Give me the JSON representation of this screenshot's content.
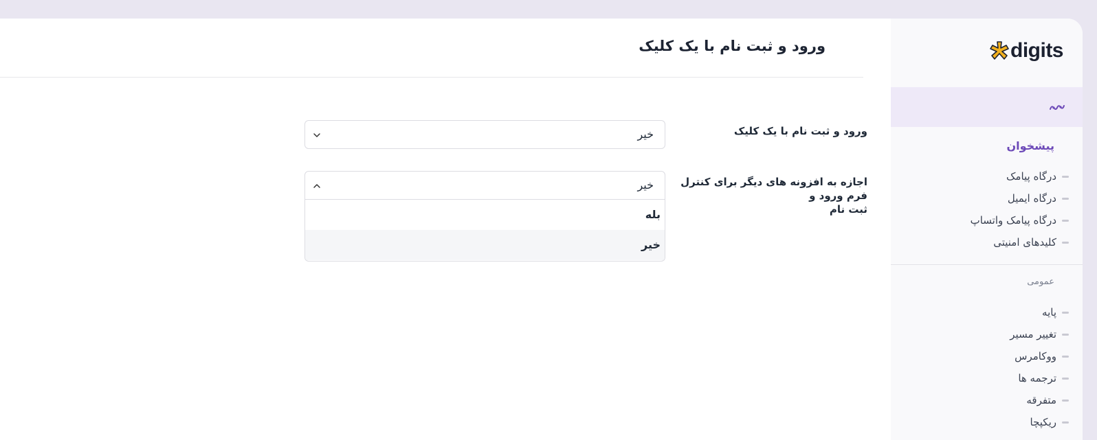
{
  "header": {
    "title": "ورود و ثبت نام با یک کلیک"
  },
  "settings": [
    {
      "label": "ورود و ثبت نام با یک کلیک",
      "value": "خیر"
    },
    {
      "label_line1": "اجازه به افزونه های دیگر برای کنترل فرم ورود و",
      "label_line2": "ثبت نام",
      "value": "خیر",
      "options": [
        "بله",
        "خیر"
      ],
      "selected": "خیر"
    }
  ],
  "sidebar": {
    "logo": "digits",
    "dashboard_icon": "activity-icon",
    "section1_title": "پیشخوان",
    "section1_items": [
      "درگاه پیامک",
      "درگاه ایمیل",
      "درگاه پیامک واتساپ",
      "کلیدهای امنیتی"
    ],
    "section2_title": "عمومی",
    "section2_items": [
      "پایه",
      "تغییر مسیر",
      "ووکامرس",
      "ترجمه ها",
      "متفرقه",
      "ریکپچا"
    ],
    "accent": "#6d4ab8",
    "logo_color": "#f2b01e"
  }
}
